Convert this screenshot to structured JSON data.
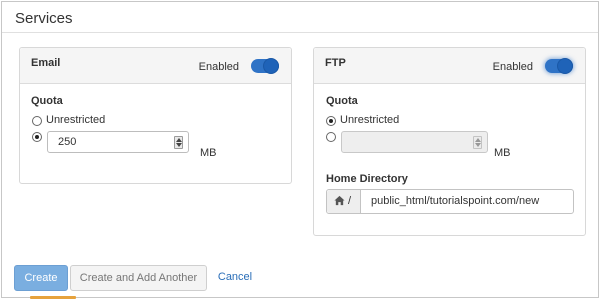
{
  "section": {
    "title": "Services"
  },
  "email": {
    "title": "Email",
    "enabled_label": "Enabled",
    "enabled": true,
    "quota_label": "Quota",
    "unrestricted_label": "Unrestricted",
    "unrestricted_selected": false,
    "quota_value": "250",
    "unit": "MB"
  },
  "ftp": {
    "title": "FTP",
    "enabled_label": "Enabled",
    "enabled": true,
    "quota_label": "Quota",
    "unrestricted_label": "Unrestricted",
    "unrestricted_selected": true,
    "quota_value": "",
    "unit": "MB",
    "home_dir_label": "Home Directory",
    "home_prefix": "/",
    "home_dir_value": "public_html/tutorialspoint.com/new"
  },
  "actions": {
    "create": "Create",
    "create_another": "Create and Add Another",
    "cancel": "Cancel"
  },
  "icons": {
    "home": "home-icon",
    "toggle": "toggle-switch"
  },
  "colors": {
    "accent": "#2f73c6",
    "primary_button": "#7aaee0",
    "link": "#2a6eb8"
  }
}
